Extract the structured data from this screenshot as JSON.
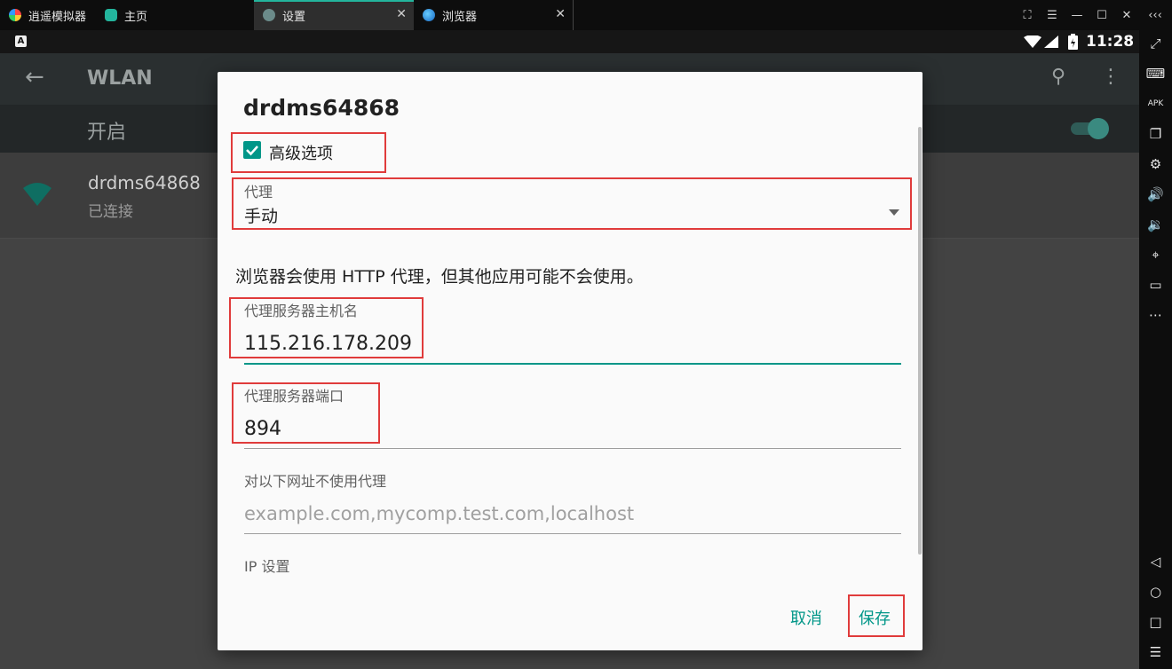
{
  "emulator": {
    "tabs": [
      {
        "label": "逍遥模拟器",
        "icon": "memu-logo-icon"
      },
      {
        "label": "主页",
        "icon": "home-app-icon"
      },
      {
        "label": "设置",
        "icon": "settings-gear-icon"
      },
      {
        "label": "浏览器",
        "icon": "browser-globe-icon"
      }
    ],
    "window_controls": [
      "screenshot-icon",
      "menu-icon",
      "minimize-icon",
      "maximize-icon",
      "close-icon",
      "collapse-icon"
    ],
    "sidebar_icons": [
      "fullscreen-icon",
      "keyboard-icon",
      "apk-install-icon",
      "multi-window-icon",
      "settings-icon",
      "volume-up-icon",
      "volume-down-icon",
      "location-icon",
      "folder-icon",
      "more-icon",
      "back-nav-icon",
      "home-nav-icon",
      "recent-apps-icon",
      "menu-list-icon"
    ],
    "accent_color": "#23b59d"
  },
  "status_bar": {
    "time": "11:28",
    "notification_icon_letter": "A"
  },
  "wlan_screen": {
    "title": "WLAN",
    "switch_label": "开启",
    "switch_on": true,
    "network": {
      "name": "drdms64868",
      "status": "已连接"
    }
  },
  "dialog": {
    "title": "drdms64868",
    "advanced_label": "高级选项",
    "advanced_checked": true,
    "proxy": {
      "label": "代理",
      "value": "手动"
    },
    "info_text": "浏览器会使用 HTTP 代理，但其他应用可能不会使用。",
    "hostname": {
      "label": "代理服务器主机名",
      "value": "115.216.178.209"
    },
    "port": {
      "label": "代理服务器端口",
      "value": "894"
    },
    "bypass": {
      "label": "对以下网址不使用代理",
      "placeholder": "example.com,mycomp.test.com,localhost"
    },
    "ip_settings_label": "IP 设置",
    "cancel_label": "取消",
    "save_label": "保存",
    "accent_color": "#009688",
    "highlight_color": "#e03b3b"
  }
}
